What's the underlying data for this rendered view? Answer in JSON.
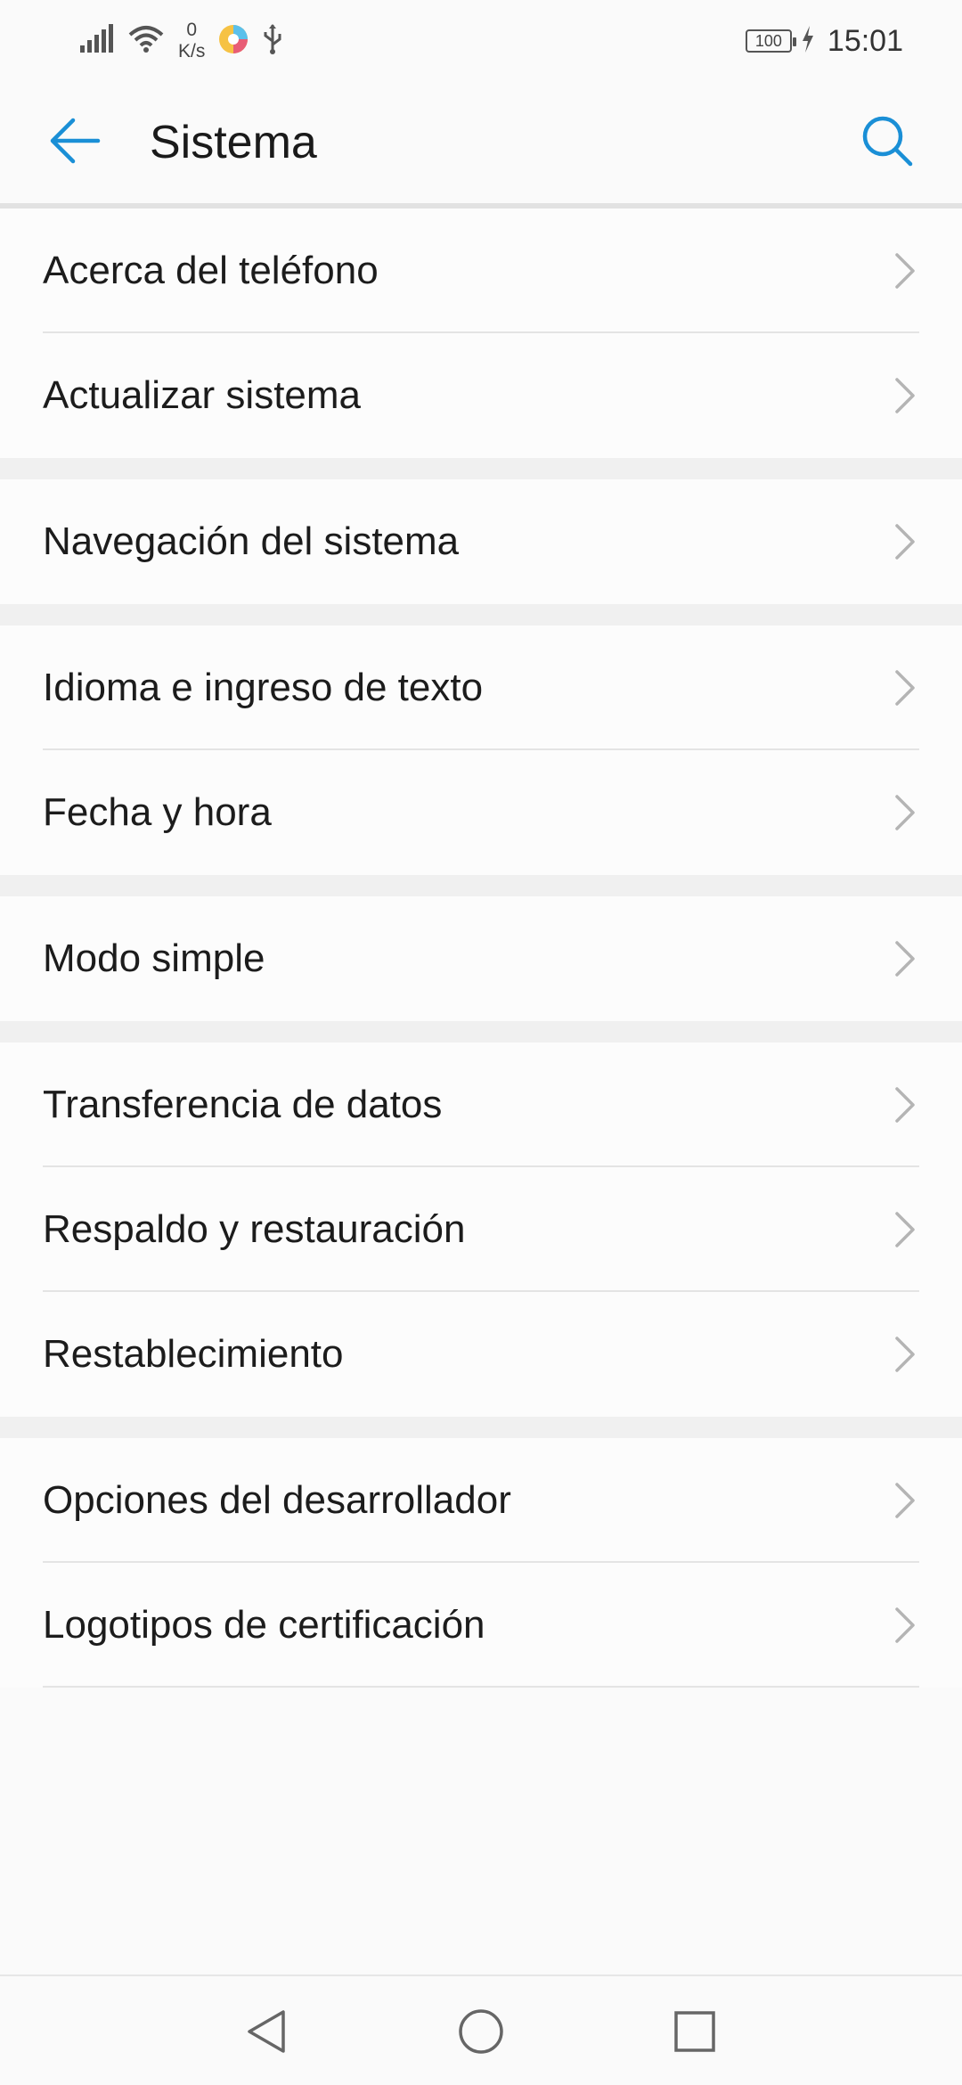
{
  "status_bar": {
    "net_speed_value": "0",
    "net_speed_unit": "K/s",
    "battery": "100",
    "time": "15:01",
    "icons": [
      "signal-icon",
      "wifi-icon",
      "app-notification-icon",
      "usb-icon",
      "battery-icon",
      "charging-icon"
    ]
  },
  "app_bar": {
    "title": "Sistema",
    "back_icon": "back-arrow-icon",
    "search_icon": "search-icon",
    "accent_color": "#1a8fd6"
  },
  "groups": [
    {
      "items": [
        {
          "label": "Acerca del teléfono"
        },
        {
          "label": "Actualizar sistema"
        }
      ]
    },
    {
      "items": [
        {
          "label": "Navegación del sistema"
        }
      ]
    },
    {
      "items": [
        {
          "label": "Idioma e ingreso de texto"
        },
        {
          "label": "Fecha y hora"
        }
      ]
    },
    {
      "items": [
        {
          "label": "Modo simple"
        }
      ]
    },
    {
      "items": [
        {
          "label": "Transferencia de datos"
        },
        {
          "label": "Respaldo y restauración"
        },
        {
          "label": "Restablecimiento"
        }
      ]
    },
    {
      "items": [
        {
          "label": "Opciones del desarrollador"
        },
        {
          "label": "Logotipos de certificación"
        }
      ]
    }
  ],
  "nav_bar": {
    "icons": [
      "nav-back-icon",
      "nav-home-icon",
      "nav-recents-icon"
    ]
  }
}
